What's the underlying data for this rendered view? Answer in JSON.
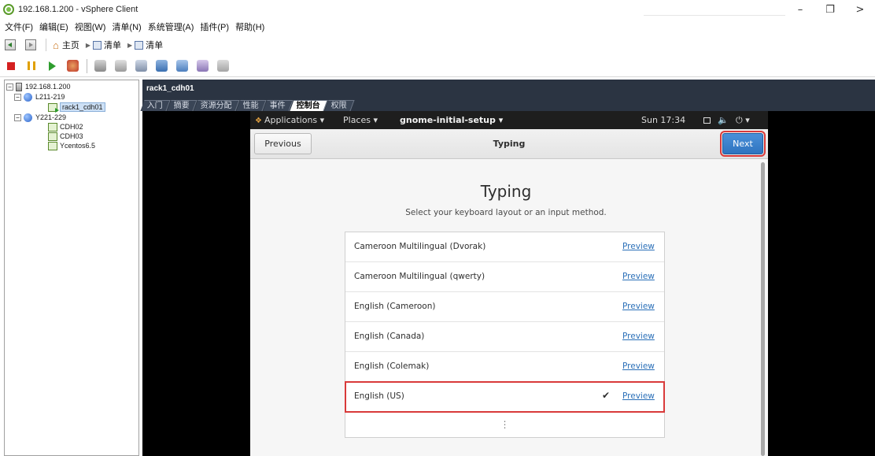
{
  "window": {
    "title": "192.168.1.200 - vSphere Client",
    "controls": {
      "minimize": "–",
      "maximize": "❐",
      "close": ">"
    }
  },
  "menu": {
    "items": [
      "文件(F)",
      "编辑(E)",
      "视图(W)",
      "清单(N)",
      "系统管理(A)",
      "插件(P)",
      "帮助(H)"
    ]
  },
  "nav": {
    "home": "主页",
    "crumb1": "清单",
    "crumb2": "清单"
  },
  "tree": {
    "host": "192.168.1.200",
    "dc1": "L211-219",
    "vm_selected": "rack1_cdh01",
    "dc2": "Y221-229",
    "vm2": "CDH02",
    "vm3": "CDH03",
    "vm4": "Ycentos6.5",
    "expander_open": "−"
  },
  "vm_panel": {
    "title": "rack1_cdh01",
    "tabs": [
      "入门",
      "摘要",
      "资源分配",
      "性能",
      "事件",
      "控制台",
      "权限"
    ],
    "active_tab": "控制台"
  },
  "guest": {
    "topbar": {
      "applications": "Applications ▾",
      "places": "Places ▾",
      "app_name": "gnome-initial-setup ▾",
      "clock": "Sun 17:34",
      "volume": "🔈",
      "power": "⏻ ▾"
    },
    "header": {
      "previous_button": "Previous",
      "title": "Typing",
      "next_button": "Next"
    },
    "page": {
      "heading": "Typing",
      "subtitle": "Select your keyboard layout or an input method."
    },
    "layouts": [
      {
        "label": "Cameroon Multilingual (Dvorak)",
        "link": "Preview",
        "selected": false
      },
      {
        "label": "Cameroon Multilingual (qwerty)",
        "link": "Preview",
        "selected": false
      },
      {
        "label": "English (Cameroon)",
        "link": "Preview",
        "selected": false
      },
      {
        "label": "English (Canada)",
        "link": "Preview",
        "selected": false
      },
      {
        "label": "English (Colemak)",
        "link": "Preview",
        "selected": false
      },
      {
        "label": "English (US)",
        "link": "Preview",
        "selected": true,
        "check": "✔"
      }
    ],
    "more_icon": "⋮"
  },
  "colors": {
    "highlight": "#d93a3a",
    "accent_blue": "#2f74c0",
    "vm_header": "#2b3442",
    "link": "#2a6fb8"
  }
}
